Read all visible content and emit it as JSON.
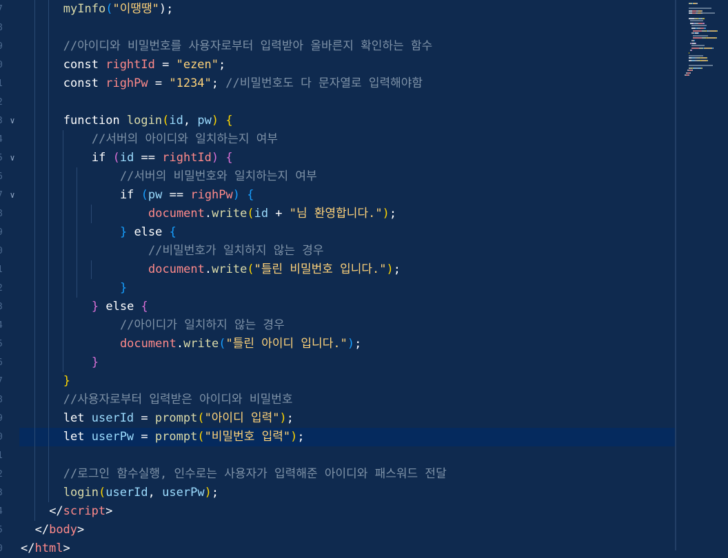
{
  "editor": {
    "language": "html",
    "colors": {
      "background": "#0f2a4f",
      "active_line": "#052a5e",
      "keyword": "#ffffff",
      "function": "#dcdcaa",
      "variable": "#9cdcfe",
      "constant": "#ff8a8a",
      "string": "#ffd37a",
      "comment": "#7f93a8",
      "bracket_1": "#ffd700",
      "bracket_2": "#da70d6",
      "bracket_3": "#179fff"
    },
    "gutter_numbers": [
      "7",
      "8",
      "9",
      "0",
      "1",
      "2",
      "3",
      "4",
      "5",
      "6",
      "7",
      "8",
      "9",
      "0",
      "1",
      "2",
      "3",
      "4",
      "5",
      "6",
      "7",
      "8",
      "9",
      "0",
      "1",
      "2",
      "3",
      "4",
      "5",
      "0"
    ],
    "lines": [
      [
        {
          "t": "myInfo",
          "c": "fn"
        },
        {
          "t": "(",
          "c": "b3"
        },
        {
          "t": "\"이땡땡\"",
          "c": "str"
        },
        {
          "t": ");",
          "c": "pun"
        }
      ],
      [],
      [
        {
          "t": "//아이디와 비밀번호를 사용자로부터 입력받아 올바른지 확인하는 함수",
          "c": "cmt"
        }
      ],
      [
        {
          "t": "const ",
          "c": "kw"
        },
        {
          "t": "rightId",
          "c": "cst"
        },
        {
          "t": " = ",
          "c": "pun"
        },
        {
          "t": "\"ezen\"",
          "c": "str"
        },
        {
          "t": ";",
          "c": "pun"
        }
      ],
      [
        {
          "t": "const ",
          "c": "kw"
        },
        {
          "t": "righPw",
          "c": "cst"
        },
        {
          "t": " = ",
          "c": "pun"
        },
        {
          "t": "\"1234\"",
          "c": "str"
        },
        {
          "t": "; ",
          "c": "pun"
        },
        {
          "t": "//비밀번호도 다 문자열로 입력해야함",
          "c": "cmt"
        }
      ],
      [],
      [
        {
          "t": "function ",
          "c": "kw"
        },
        {
          "t": "login",
          "c": "fn"
        },
        {
          "t": "(",
          "c": "b1"
        },
        {
          "t": "id",
          "c": "var"
        },
        {
          "t": ", ",
          "c": "pun"
        },
        {
          "t": "pw",
          "c": "var"
        },
        {
          "t": ")",
          "c": "b1"
        },
        {
          "t": " ",
          "c": "pun"
        },
        {
          "t": "{",
          "c": "b1"
        }
      ],
      [
        {
          "t": "  //서버의 아이디와 일치하는지 여부",
          "c": "cmt"
        }
      ],
      [
        {
          "t": "  if ",
          "c": "kw"
        },
        {
          "t": "(",
          "c": "b2"
        },
        {
          "t": "id",
          "c": "var"
        },
        {
          "t": " == ",
          "c": "pun"
        },
        {
          "t": "rightId",
          "c": "cst"
        },
        {
          "t": ")",
          "c": "b2"
        },
        {
          "t": " ",
          "c": "pun"
        },
        {
          "t": "{",
          "c": "b2"
        }
      ],
      [
        {
          "t": "    //서버의 비밀번호와 일치하는지 여부",
          "c": "cmt"
        }
      ],
      [
        {
          "t": "    if ",
          "c": "kw"
        },
        {
          "t": "(",
          "c": "b3"
        },
        {
          "t": "pw",
          "c": "var"
        },
        {
          "t": " == ",
          "c": "pun"
        },
        {
          "t": "righPw",
          "c": "cst"
        },
        {
          "t": ")",
          "c": "b3"
        },
        {
          "t": " ",
          "c": "pun"
        },
        {
          "t": "{",
          "c": "b3"
        }
      ],
      [
        {
          "t": "      document",
          "c": "cst"
        },
        {
          "t": ".",
          "c": "pun"
        },
        {
          "t": "write",
          "c": "fn"
        },
        {
          "t": "(",
          "c": "b1"
        },
        {
          "t": "id",
          "c": "var"
        },
        {
          "t": " + ",
          "c": "pun"
        },
        {
          "t": "\"님 환영합니다.\"",
          "c": "str"
        },
        {
          "t": ")",
          "c": "b1"
        },
        {
          "t": ";",
          "c": "pun"
        }
      ],
      [
        {
          "t": "    ",
          "c": "pun"
        },
        {
          "t": "}",
          "c": "b3"
        },
        {
          "t": " else ",
          "c": "kw"
        },
        {
          "t": "{",
          "c": "b3"
        }
      ],
      [
        {
          "t": "      //비밀번호가 일치하지 않는 경우",
          "c": "cmt"
        }
      ],
      [
        {
          "t": "      document",
          "c": "cst"
        },
        {
          "t": ".",
          "c": "pun"
        },
        {
          "t": "write",
          "c": "fn"
        },
        {
          "t": "(",
          "c": "b1"
        },
        {
          "t": "\"틀린 비밀번호 입니다.\"",
          "c": "str"
        },
        {
          "t": ")",
          "c": "b1"
        },
        {
          "t": ";",
          "c": "pun"
        }
      ],
      [
        {
          "t": "    ",
          "c": "pun"
        },
        {
          "t": "}",
          "c": "b3"
        }
      ],
      [
        {
          "t": "  ",
          "c": "pun"
        },
        {
          "t": "}",
          "c": "b2"
        },
        {
          "t": " else ",
          "c": "kw"
        },
        {
          "t": "{",
          "c": "b2"
        }
      ],
      [
        {
          "t": "    //아이디가 일치하지 않는 경우",
          "c": "cmt"
        }
      ],
      [
        {
          "t": "    document",
          "c": "cst"
        },
        {
          "t": ".",
          "c": "pun"
        },
        {
          "t": "write",
          "c": "fn"
        },
        {
          "t": "(",
          "c": "b3"
        },
        {
          "t": "\"틀린 아이디 입니다.\"",
          "c": "str"
        },
        {
          "t": ")",
          "c": "b3"
        },
        {
          "t": ";",
          "c": "pun"
        }
      ],
      [
        {
          "t": "  ",
          "c": "pun"
        },
        {
          "t": "}",
          "c": "b2"
        }
      ],
      [
        {
          "t": "}",
          "c": "b1"
        }
      ],
      [
        {
          "t": "//사용자로부터 입력받은 아이디와 비밀번호",
          "c": "cmt"
        }
      ],
      [
        {
          "t": "let ",
          "c": "kw"
        },
        {
          "t": "userId",
          "c": "var"
        },
        {
          "t": " = ",
          "c": "pun"
        },
        {
          "t": "prompt",
          "c": "fn"
        },
        {
          "t": "(",
          "c": "b1"
        },
        {
          "t": "\"아이디 입력\"",
          "c": "str"
        },
        {
          "t": ")",
          "c": "b1"
        },
        {
          "t": ";",
          "c": "pun"
        }
      ],
      [
        {
          "t": "let ",
          "c": "kw"
        },
        {
          "t": "userPw",
          "c": "var"
        },
        {
          "t": " = ",
          "c": "pun"
        },
        {
          "t": "prompt",
          "c": "fn"
        },
        {
          "t": "(",
          "c": "b1"
        },
        {
          "t": "\"비밀번호 입력\"",
          "c": "str"
        },
        {
          "t": ")",
          "c": "b1"
        },
        {
          "t": ";",
          "c": "pun"
        }
      ],
      [],
      [
        {
          "t": "//로그인 함수실행, 인수로는 사용자가 입력해준 아이디와 패스워드 전달",
          "c": "cmt"
        }
      ],
      [
        {
          "t": "login",
          "c": "fn"
        },
        {
          "t": "(",
          "c": "b1"
        },
        {
          "t": "userId",
          "c": "var"
        },
        {
          "t": ", ",
          "c": "pun"
        },
        {
          "t": "userPw",
          "c": "var"
        },
        {
          "t": ")",
          "c": "b1"
        },
        {
          "t": ";",
          "c": "pun"
        }
      ],
      [
        {
          "t": "</",
          "c": "pun"
        },
        {
          "t": "script",
          "c": "tag"
        },
        {
          "t": ">",
          "c": "pun"
        }
      ],
      [
        {
          "t": "</",
          "c": "pun"
        },
        {
          "t": "body",
          "c": "tag"
        },
        {
          "t": ">",
          "c": "pun"
        }
      ],
      [
        {
          "t": "</",
          "c": "pun"
        },
        {
          "t": "html",
          "c": "tag"
        },
        {
          "t": ">",
          "c": "pun"
        }
      ]
    ]
  }
}
